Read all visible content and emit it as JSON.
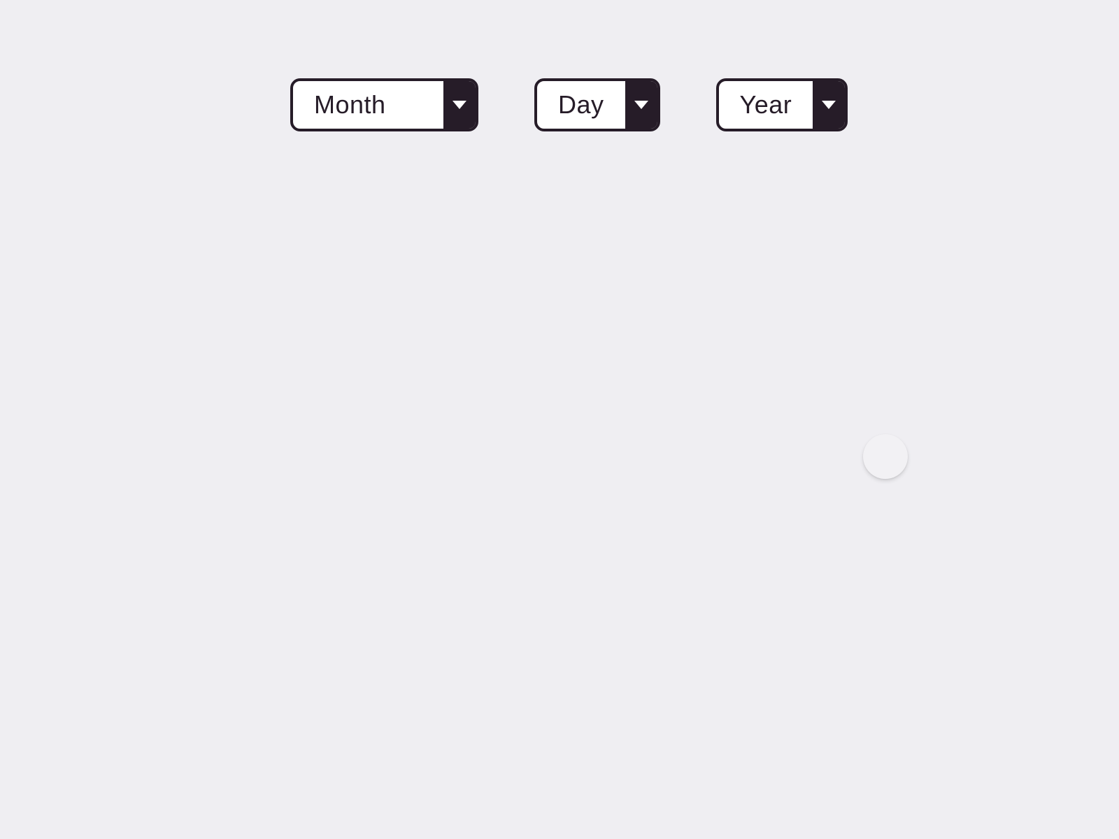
{
  "dropdowns": {
    "month": {
      "label": "Month"
    },
    "day": {
      "label": "Day"
    },
    "year": {
      "label": "Year"
    }
  }
}
